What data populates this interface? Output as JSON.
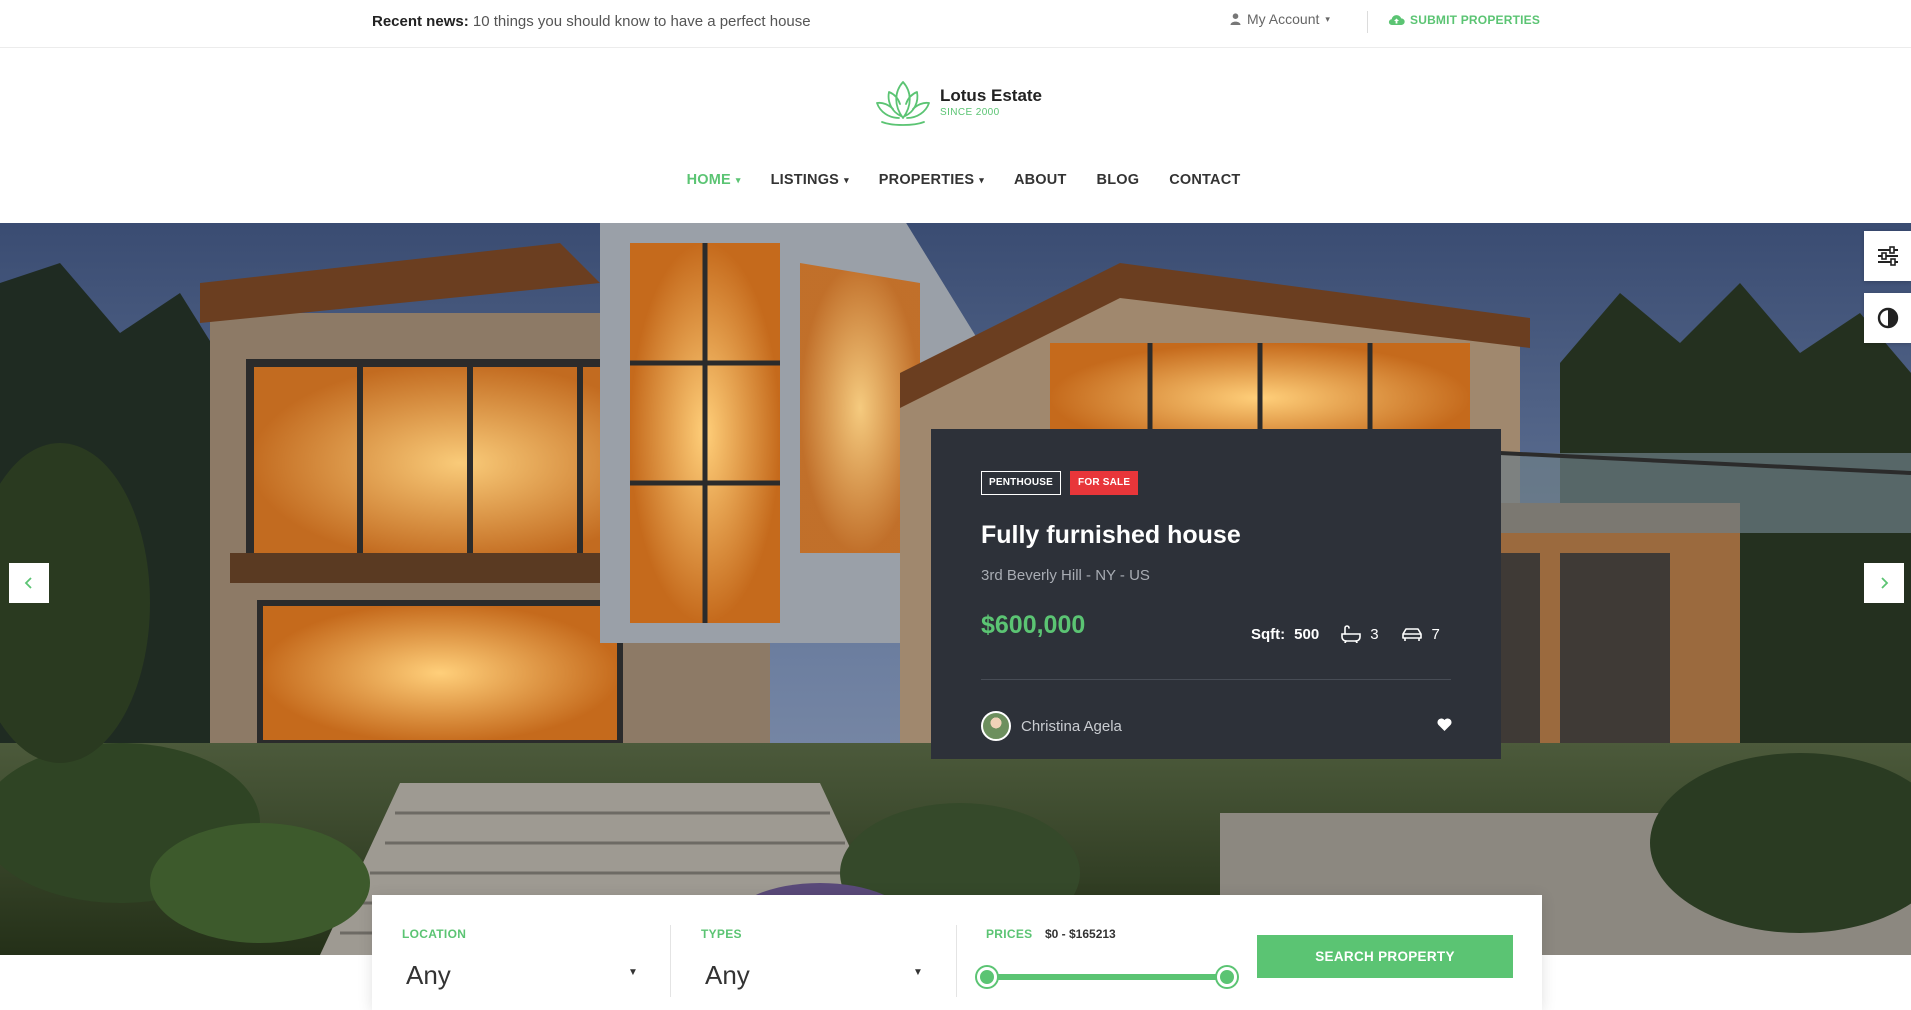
{
  "topbar": {
    "news_label": "Recent news:",
    "news_text": "10 things you should know to have a perfect house",
    "account_label": "My Account",
    "submit_label": "SUBMIT PROPERTIES"
  },
  "brand": {
    "name": "Lotus Estate",
    "tagline": "SINCE 2000",
    "accent_color": "#5bc473"
  },
  "nav": {
    "items": [
      {
        "label": "HOME",
        "active": true,
        "dropdown": true
      },
      {
        "label": "LISTINGS",
        "active": false,
        "dropdown": true
      },
      {
        "label": "PROPERTIES",
        "active": false,
        "dropdown": true
      },
      {
        "label": "ABOUT",
        "active": false,
        "dropdown": false
      },
      {
        "label": "BLOG",
        "active": false,
        "dropdown": false
      },
      {
        "label": "CONTACT",
        "active": false,
        "dropdown": false
      }
    ]
  },
  "hero": {
    "image_icon": "modern-house-photo",
    "prev_icon": "chevron-left-icon",
    "next_icon": "chevron-right-icon"
  },
  "side_tools": [
    "sliders-icon",
    "contrast-icon"
  ],
  "listing": {
    "tag_type": "PENTHOUSE",
    "tag_status": "FOR SALE",
    "title": "Fully furnished house",
    "address": "3rd Beverly Hill - NY - US",
    "price": "$600,000",
    "sqft_label": "Sqft:",
    "sqft_value": "500",
    "baths": "3",
    "garages": "7",
    "agent_name": "Christina Agela",
    "status_color": "#e8363a",
    "card_color": "#2d3139"
  },
  "search": {
    "location_label": "LOCATION",
    "location_value": "Any",
    "types_label": "TYPES",
    "types_value": "Any",
    "prices_label": "PRICES",
    "price_range": "$0 - $165213",
    "button_label": "SEARCH PROPERTY"
  }
}
